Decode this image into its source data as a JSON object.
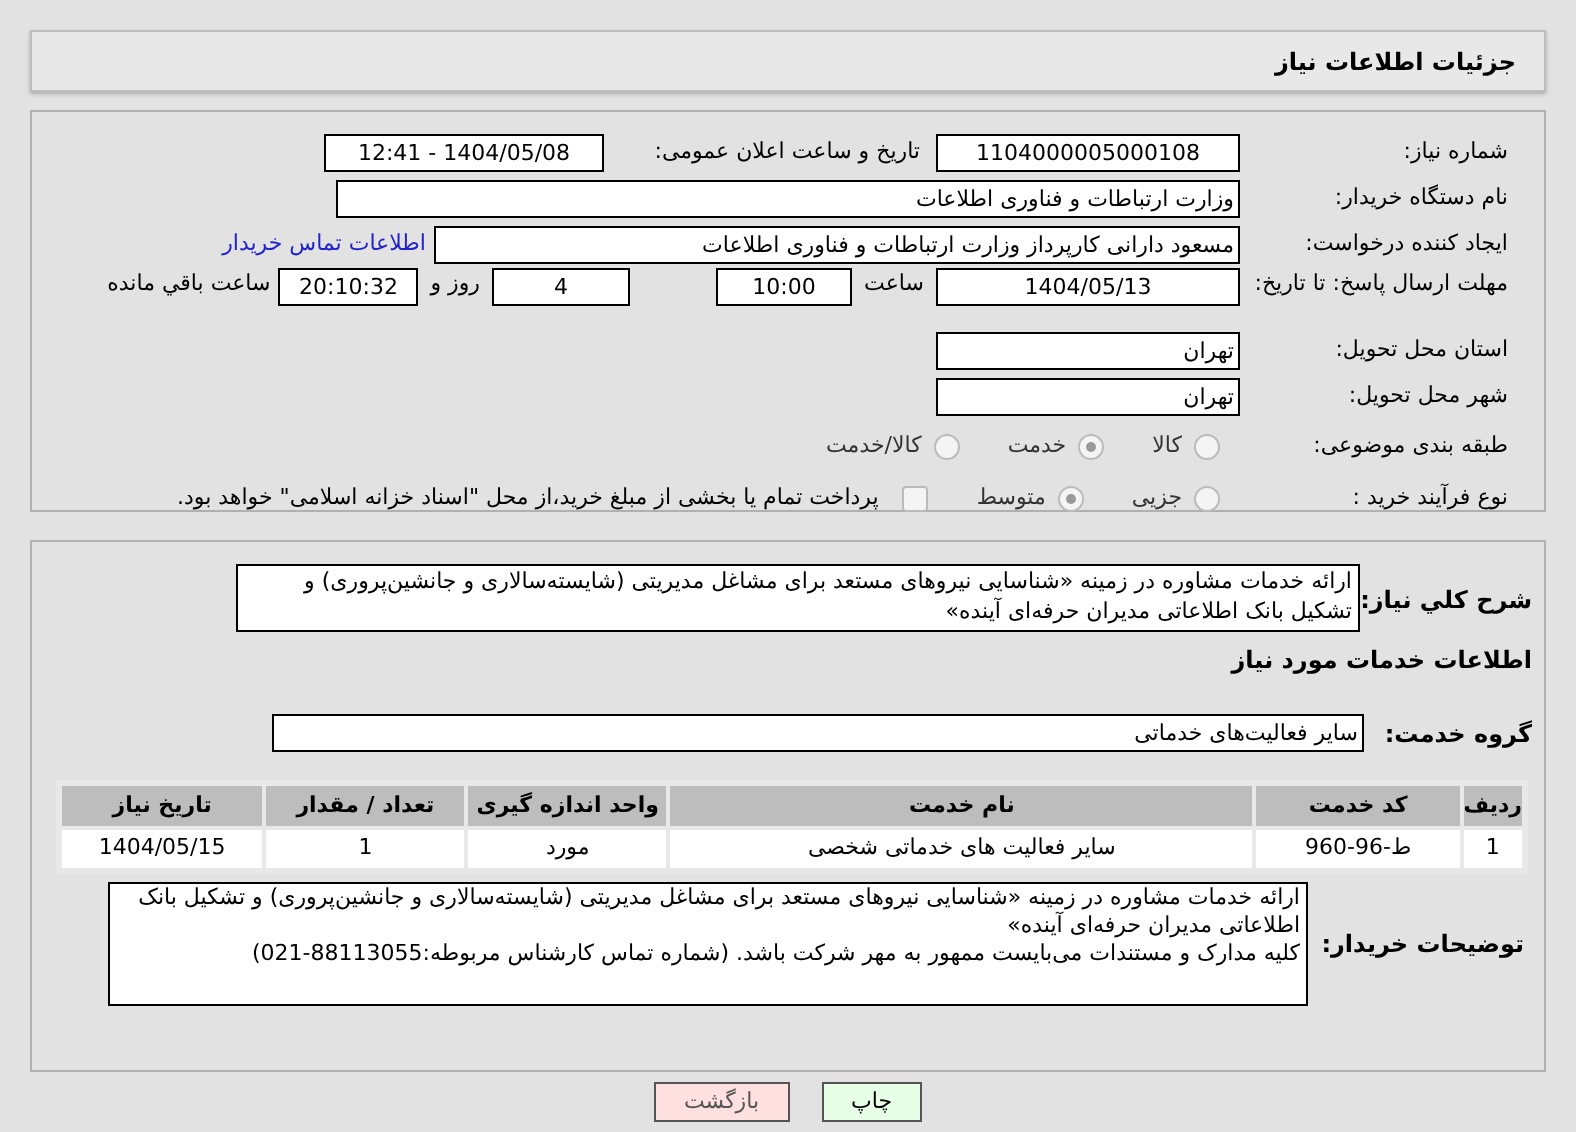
{
  "header": {
    "title": "جزئیات اطلاعات نیاز"
  },
  "need_number": {
    "label": "شماره نیاز:",
    "value": "1104000005000108"
  },
  "announce": {
    "label": "تاریخ و ساعت اعلان عمومی:",
    "value": "1404/05/08 - 12:41"
  },
  "buyer_org": {
    "label": "نام دستگاه خریدار:",
    "value": "وزارت ارتباطات و فناوری اطلاعات"
  },
  "requester": {
    "label": "ایجاد کننده درخواست:",
    "value": "مسعود دارانی کارپرداز وزارت ارتباطات و فناوری اطلاعات",
    "link": "اطلاعات تماس خریدار"
  },
  "deadline": {
    "label": "مهلت ارسال پاسخ: تا تاریخ:",
    "date": "1404/05/13",
    "time_label": "ساعت",
    "time": "10:00",
    "days": "4",
    "days_label": "روز و",
    "remaining": "20:10:32",
    "remaining_label": "ساعت باقي مانده"
  },
  "province": {
    "label": "استان محل تحویل:",
    "value": "تهران"
  },
  "city": {
    "label": "شهر محل تحویل:",
    "value": "تهران"
  },
  "category": {
    "label": "طبقه بندی موضوعی:",
    "options": [
      {
        "label": "کالا",
        "selected": false
      },
      {
        "label": "خدمت",
        "selected": true
      },
      {
        "label": "کالا/خدمت",
        "selected": false
      }
    ]
  },
  "process": {
    "label": "نوع فرآیند خرید :",
    "options": [
      {
        "label": "جزیی",
        "selected": false
      },
      {
        "label": "متوسط",
        "selected": true
      }
    ],
    "treasury": {
      "checked": false,
      "label": "پرداخت تمام یا بخشی از مبلغ خرید،از محل \"اسناد خزانه اسلامی\" خواهد بود."
    }
  },
  "description": {
    "label": "شرح کلي نیاز:",
    "value": "ارائه خدمات مشاوره در زمینه «شناسایی نیروهای مستعد برای مشاغل مدیریتی (شایسته‌سالاری و جانشین‌پروری) و تشکیل بانک اطلاعاتی مدیران حرفه‌ای آینده»"
  },
  "services_heading": "اطلاعات خدمات مورد نیاز",
  "service_group": {
    "label": "گروه خدمت:",
    "value": "سایر فعالیت‌های خدماتی"
  },
  "table": {
    "columns": [
      "ردیف",
      "کد خدمت",
      "نام خدمت",
      "واحد اندازه گیری",
      "تعداد / مقدار",
      "تاریخ نیاز"
    ],
    "rows": [
      [
        "1",
        "ط-96-960",
        "سایر فعالیت های خدماتی شخصی",
        "مورد",
        "1",
        "1404/05/15"
      ]
    ]
  },
  "buyer_notes": {
    "label": "توضیحات خریدار:",
    "value": "ارائه خدمات مشاوره در زمینه «شناسایی نیروهای مستعد برای مشاغل مدیریتی (شایسته‌سالاری و جانشین‌پروری) و تشکیل بانک اطلاعاتی مدیران حرفه‌ای آینده»\nکلیه مدارک و مستندات می‌بایست ممهور به مهر شرکت باشد. (شماره تماس کارشناس مربوطه:88113055-021)"
  },
  "buttons": [
    {
      "label": "چاپ",
      "kind": "print"
    },
    {
      "label": "بازگشت",
      "kind": "back"
    }
  ]
}
